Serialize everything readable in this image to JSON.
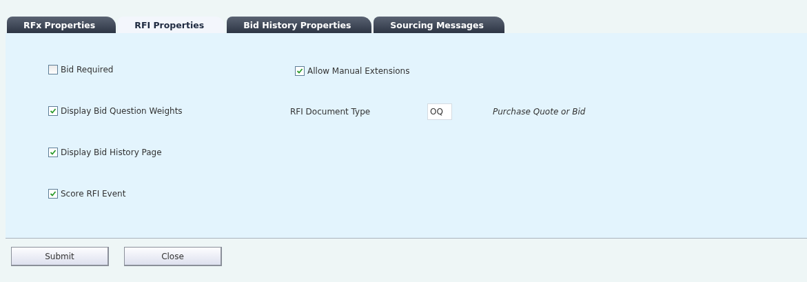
{
  "tabs": [
    {
      "label": "RFx Properties",
      "selected": false
    },
    {
      "label": "RFI Properties",
      "selected": true
    },
    {
      "label": "Bid History Properties",
      "selected": false
    },
    {
      "label": "Sourcing Messages",
      "selected": false
    }
  ],
  "left_options": [
    {
      "label": "Bid Required",
      "checked": false
    },
    {
      "label": "Display Bid Question Weights",
      "checked": true
    },
    {
      "label": "Display Bid History Page",
      "checked": true
    },
    {
      "label": "Score RFI Event",
      "checked": true
    }
  ],
  "allow_manual_extensions": {
    "label": "Allow Manual Extensions",
    "checked": true
  },
  "rfi_document_type": {
    "label": "RFI Document Type",
    "value": "OQ",
    "description": "Purchase Quote or Bid"
  },
  "buttons": [
    "Submit",
    "Close"
  ]
}
